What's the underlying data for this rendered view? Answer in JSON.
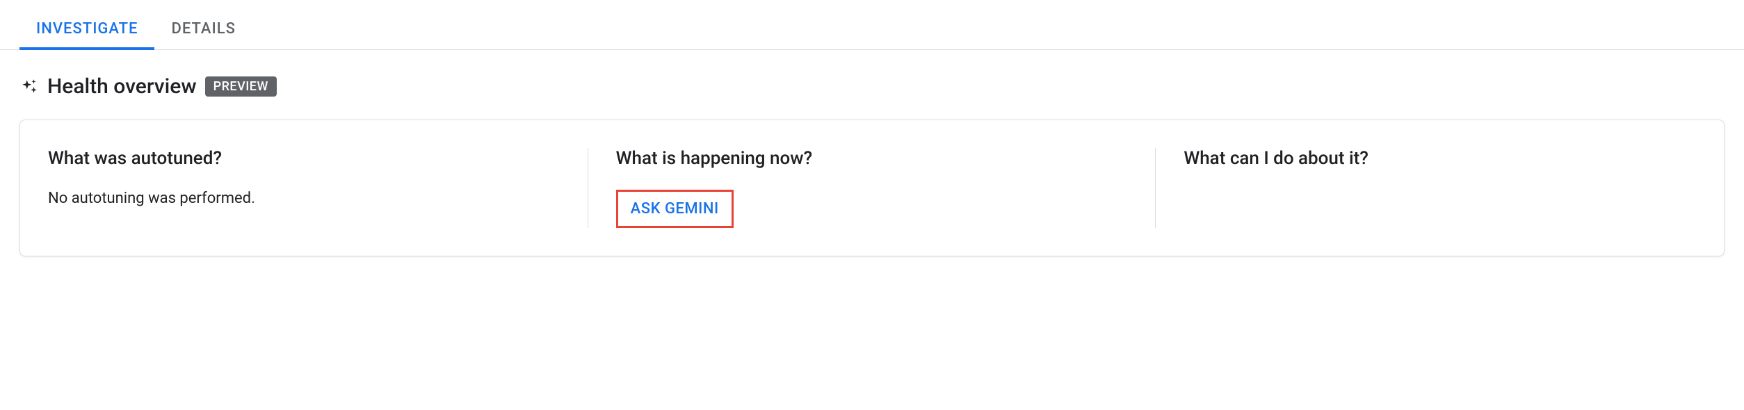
{
  "tabs": {
    "investigate": "INVESTIGATE",
    "details": "DETAILS"
  },
  "section": {
    "title": "Health overview",
    "badge": "PREVIEW"
  },
  "columns": {
    "autotuned": {
      "title": "What was autotuned?",
      "body": "No autotuning was performed."
    },
    "happening": {
      "title": "What is happening now?",
      "action": "ASK GEMINI"
    },
    "action": {
      "title": "What can I do about it?"
    }
  }
}
